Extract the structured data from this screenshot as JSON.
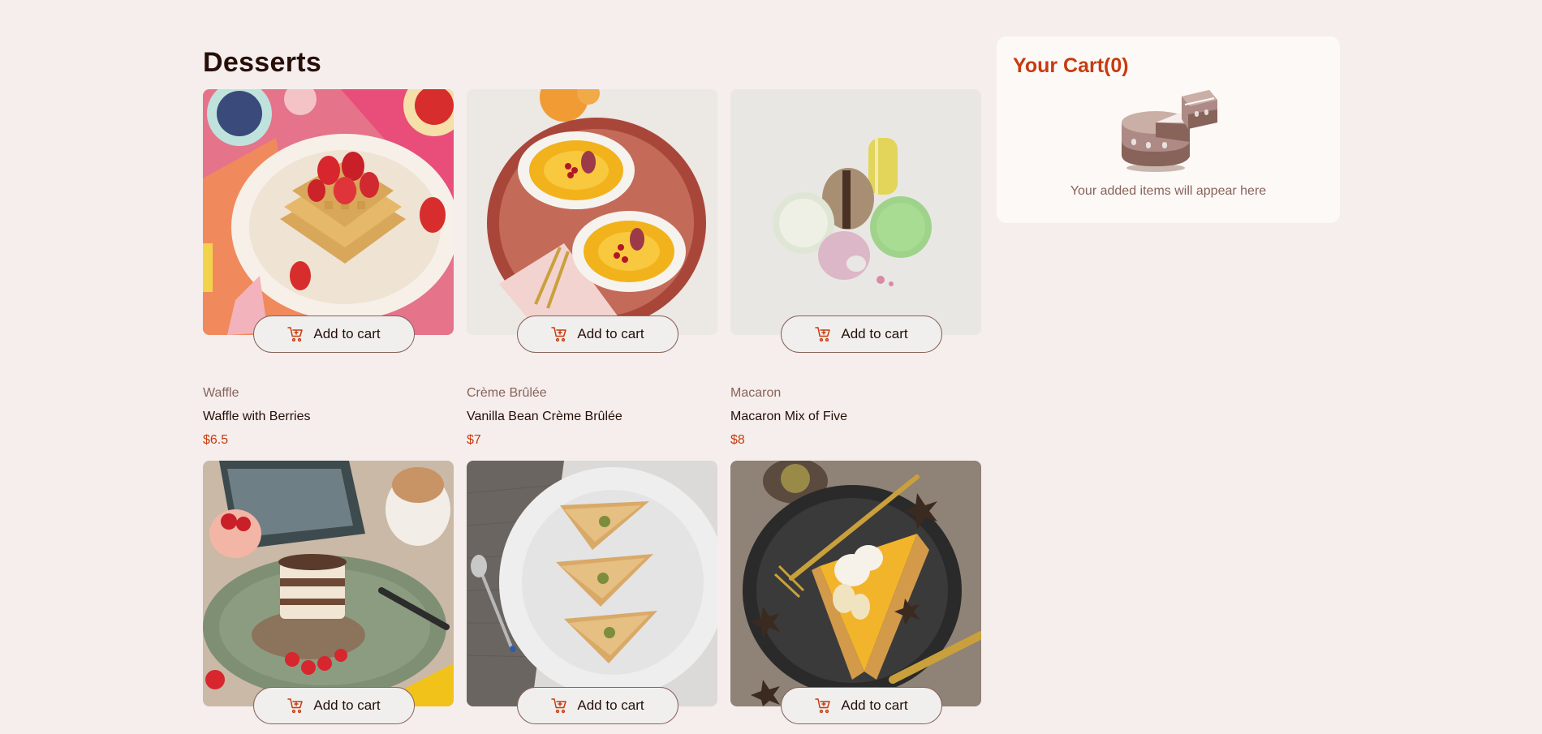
{
  "page": {
    "title": "Desserts"
  },
  "products": [
    {
      "category": "Waffle",
      "name": "Waffle with Berries",
      "price": "$6.5",
      "button_label": "Add to cart",
      "image": "waffle"
    },
    {
      "category": "Crème Brûlée",
      "name": "Vanilla Bean Crème Brûlée",
      "price": "$7",
      "button_label": "Add to cart",
      "image": "creme-brulee"
    },
    {
      "category": "Macaron",
      "name": "Macaron Mix of Five",
      "price": "$8",
      "button_label": "Add to cart",
      "image": "macaron"
    },
    {
      "category": "",
      "name": "",
      "price": "",
      "button_label": "Add to cart",
      "image": "tiramisu"
    },
    {
      "category": "",
      "name": "",
      "price": "",
      "button_label": "Add to cart",
      "image": "baklava"
    },
    {
      "category": "",
      "name": "",
      "price": "",
      "button_label": "Add to cart",
      "image": "pie"
    }
  ],
  "cart": {
    "title": "Your Cart(0)",
    "empty_message": "Your added items will appear here",
    "icon": "empty-cake-illustration"
  },
  "colors": {
    "background": "#f5eeec",
    "accent": "#c73b0f",
    "muted": "#87635a",
    "text": "#260f08"
  }
}
